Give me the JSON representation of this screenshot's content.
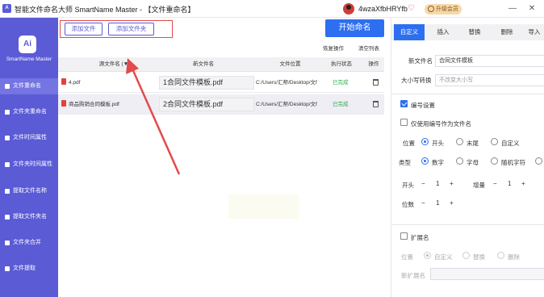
{
  "titlebar": {
    "logo_text": "A",
    "title": "智能文件命名大师 SmartName Master - 【文件重命名】",
    "user_name": "4wzaXfbHRYfb",
    "upgrade_label": "升级会员",
    "min_glyph": "—",
    "close_glyph": "✕"
  },
  "sidebar": {
    "logo_text": "Ai",
    "brand": "SmartName Master",
    "items": [
      {
        "label": "文件重命名"
      },
      {
        "label": "文件夹重命名"
      },
      {
        "label": "文件时间属性"
      },
      {
        "label": "文件夹时间属性"
      },
      {
        "label": "提取文件名称"
      },
      {
        "label": "提取文件夹名"
      },
      {
        "label": "文件夹合并"
      },
      {
        "label": "文件提取"
      }
    ]
  },
  "toolbar": {
    "add_file": "添加文件",
    "add_folder": "添加文件夹",
    "start": "开始命名",
    "restore": "恢复操作",
    "clear": "清空列表"
  },
  "table": {
    "headers": {
      "original": "源文件名 (▼)",
      "newname": "新文件名",
      "location": "文件位置",
      "status": "执行状态",
      "action": "操作"
    },
    "rows": [
      {
        "original": "4.pdf",
        "newname": "1合同文件模板.pdf",
        "location": "C:/Users/汇帮/Desktop/文f",
        "status": "已完成"
      },
      {
        "original": "商品购销合同模板.pdf",
        "newname": "2合同文件模板.pdf",
        "location": "C:/Users/汇帮/Desktop/文f",
        "status": "已完成"
      }
    ]
  },
  "right_panel": {
    "tabs": [
      "自定义",
      "插入",
      "替换",
      "删除",
      "导入"
    ],
    "new_name_label": "新文件名",
    "new_name_value": "合同文件模板",
    "case_label": "大小写转换",
    "case_placeholder": "不改变大小写",
    "numbering_label": "编号设置",
    "only_numbering_label": "仅使用编号作为文件名",
    "position_label": "位置",
    "position_options": [
      "开头",
      "末尾",
      "自定义"
    ],
    "type_label": "类型",
    "type_options": [
      "数字",
      "字母",
      "随机字符"
    ],
    "start_label": "开头",
    "start_value": "1",
    "increment_label": "增量",
    "increment_value": "1",
    "digits_label": "位数",
    "digits_value": "1",
    "extension_label": "扩展名",
    "ext_position_label": "位置",
    "ext_options": [
      "自定义",
      "替换",
      "删除"
    ],
    "new_ext_label": "新扩展名"
  },
  "colors": {
    "sidebar": "#5b5bd6",
    "primary": "#2d6ff0",
    "annotation": "#e34a4a",
    "status_ok": "#2aa84a"
  }
}
